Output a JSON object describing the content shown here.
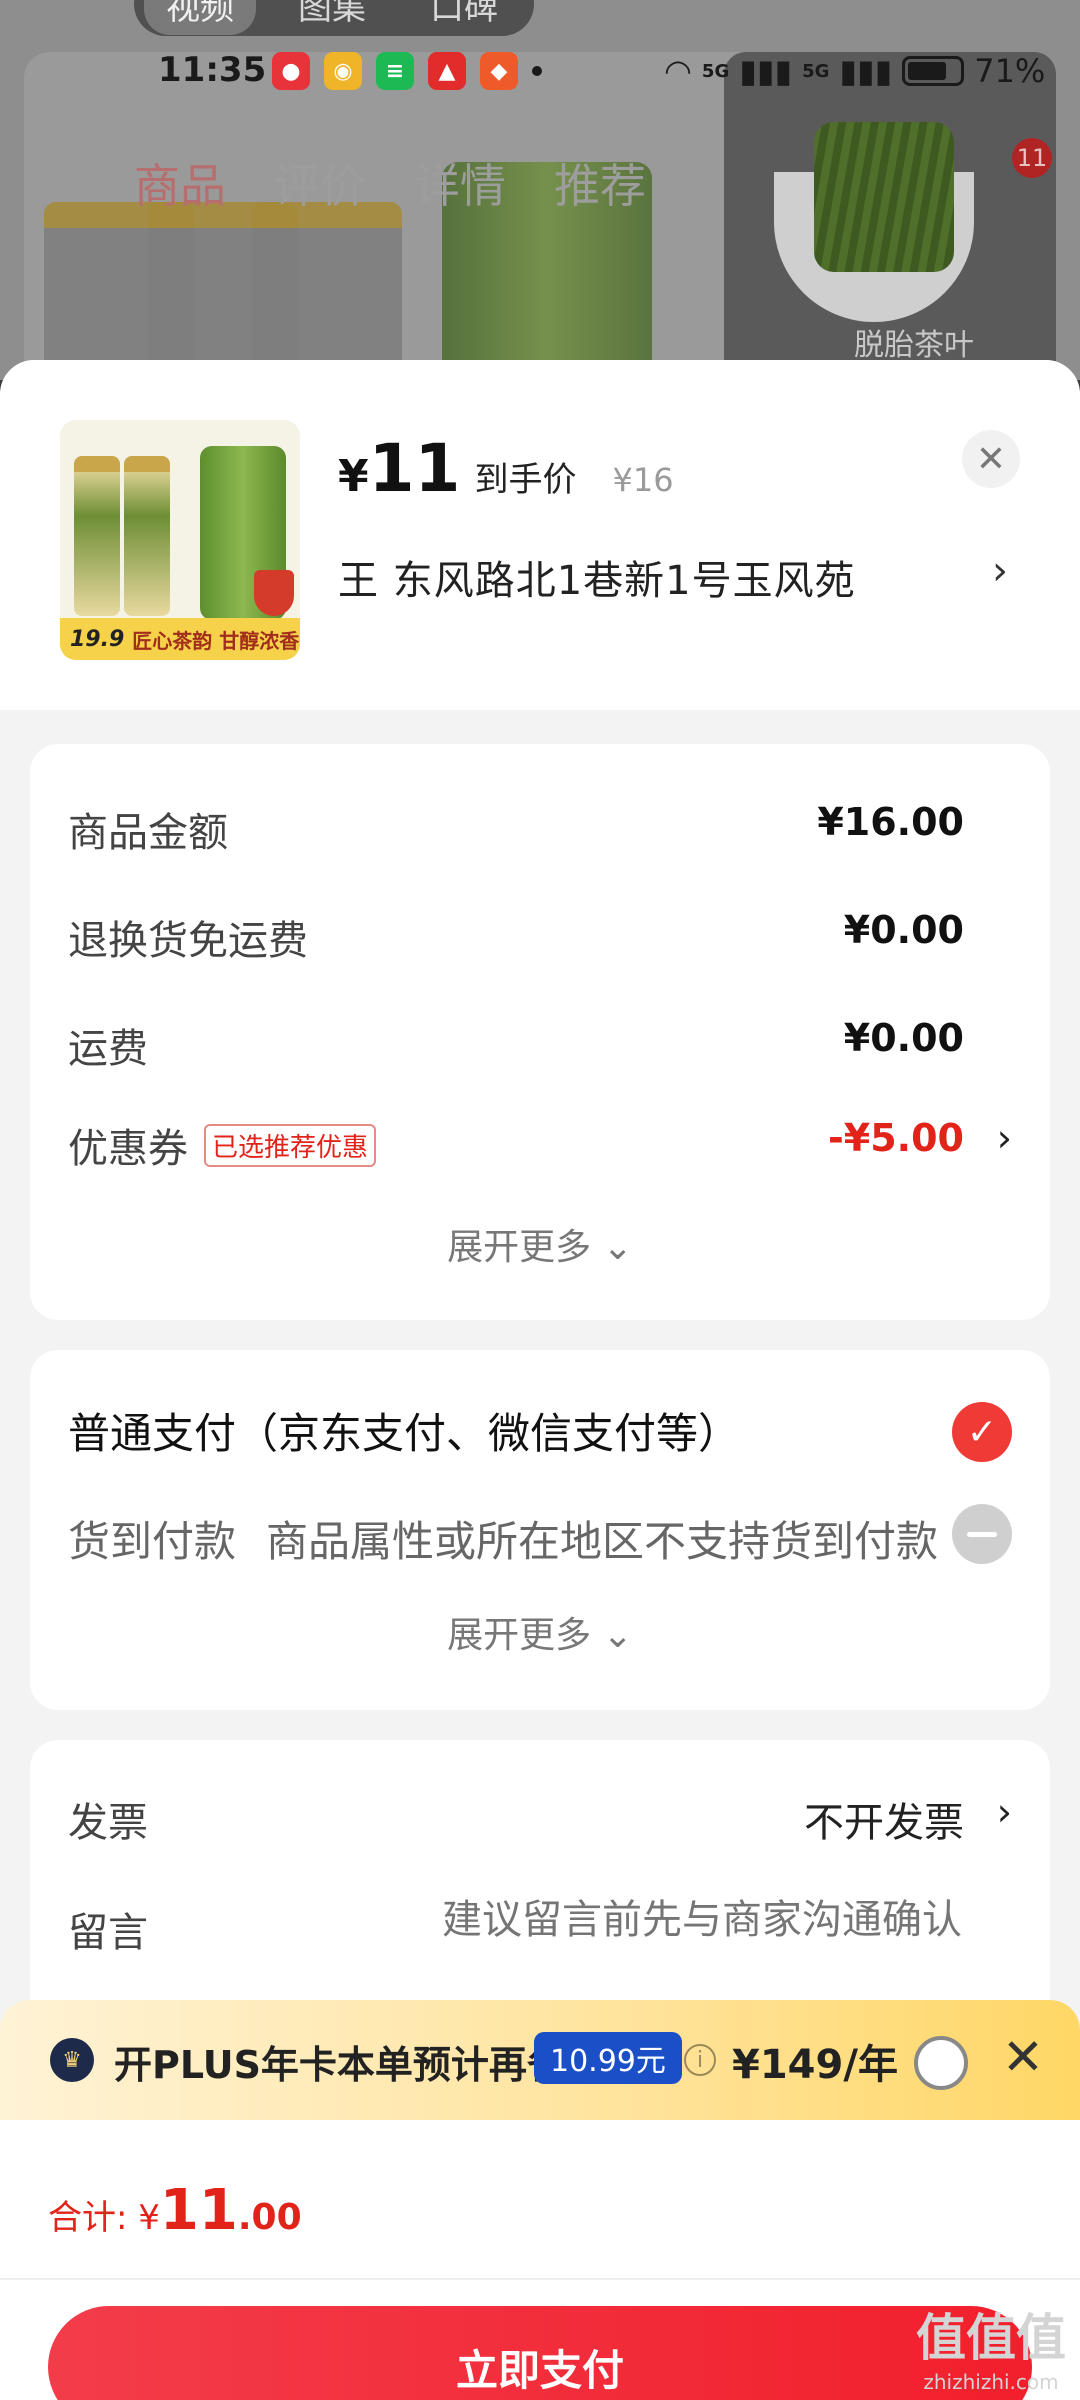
{
  "background": {
    "media_tabs": [
      "视频",
      "图集",
      "口碑"
    ],
    "page_tabs": [
      "商品",
      "评价",
      "详情",
      "推荐"
    ],
    "video_caption": "脱胎茶叶",
    "cart_badge": "11"
  },
  "status_bar": {
    "time": "11:35",
    "battery": "71%",
    "network": "5G"
  },
  "product": {
    "price_symbol": "¥",
    "price": "11",
    "price_caption": "到手价",
    "original_price": "¥16",
    "address": "王  东风路北1巷新1号玉风苑",
    "thumbnail_price_tag": "19.9",
    "thumbnail_slogan": "匠心茶韵  甘醇浓香"
  },
  "summary": {
    "rows": [
      {
        "label": "商品金额",
        "value": "¥16.00"
      },
      {
        "label": "退换货免运费",
        "value": "¥0.00"
      },
      {
        "label": "运费",
        "value": "¥0.00"
      },
      {
        "label": "优惠券",
        "tag": "已选推荐优惠",
        "value": "-¥5.00"
      }
    ],
    "expand_label": "展开更多"
  },
  "payment": {
    "standard": "普通支付（京东支付、微信支付等）",
    "cod_label": "货到付款",
    "cod_desc": "商品属性或所在地区不支持货到付款",
    "expand_label": "展开更多"
  },
  "invoice": {
    "invoice_label": "发票",
    "invoice_value": "不开发票",
    "note_label": "留言",
    "note_placeholder": "建议留言前先与商家沟通确认"
  },
  "plus_banner": {
    "text": "开PLUS年卡本单预计再省",
    "saving": "10.99元",
    "price": "¥149/年"
  },
  "total": {
    "label": "合计: ¥",
    "integer": "11",
    "decimal": ".00"
  },
  "pay_button": "立即支付",
  "watermark": {
    "top": "值值值",
    "bottom": "zhizhizhi.com"
  },
  "colors": {
    "accent_red": "#e2231a",
    "plus_blue": "#1b4fc7",
    "plus_gold": "#ffd766"
  }
}
